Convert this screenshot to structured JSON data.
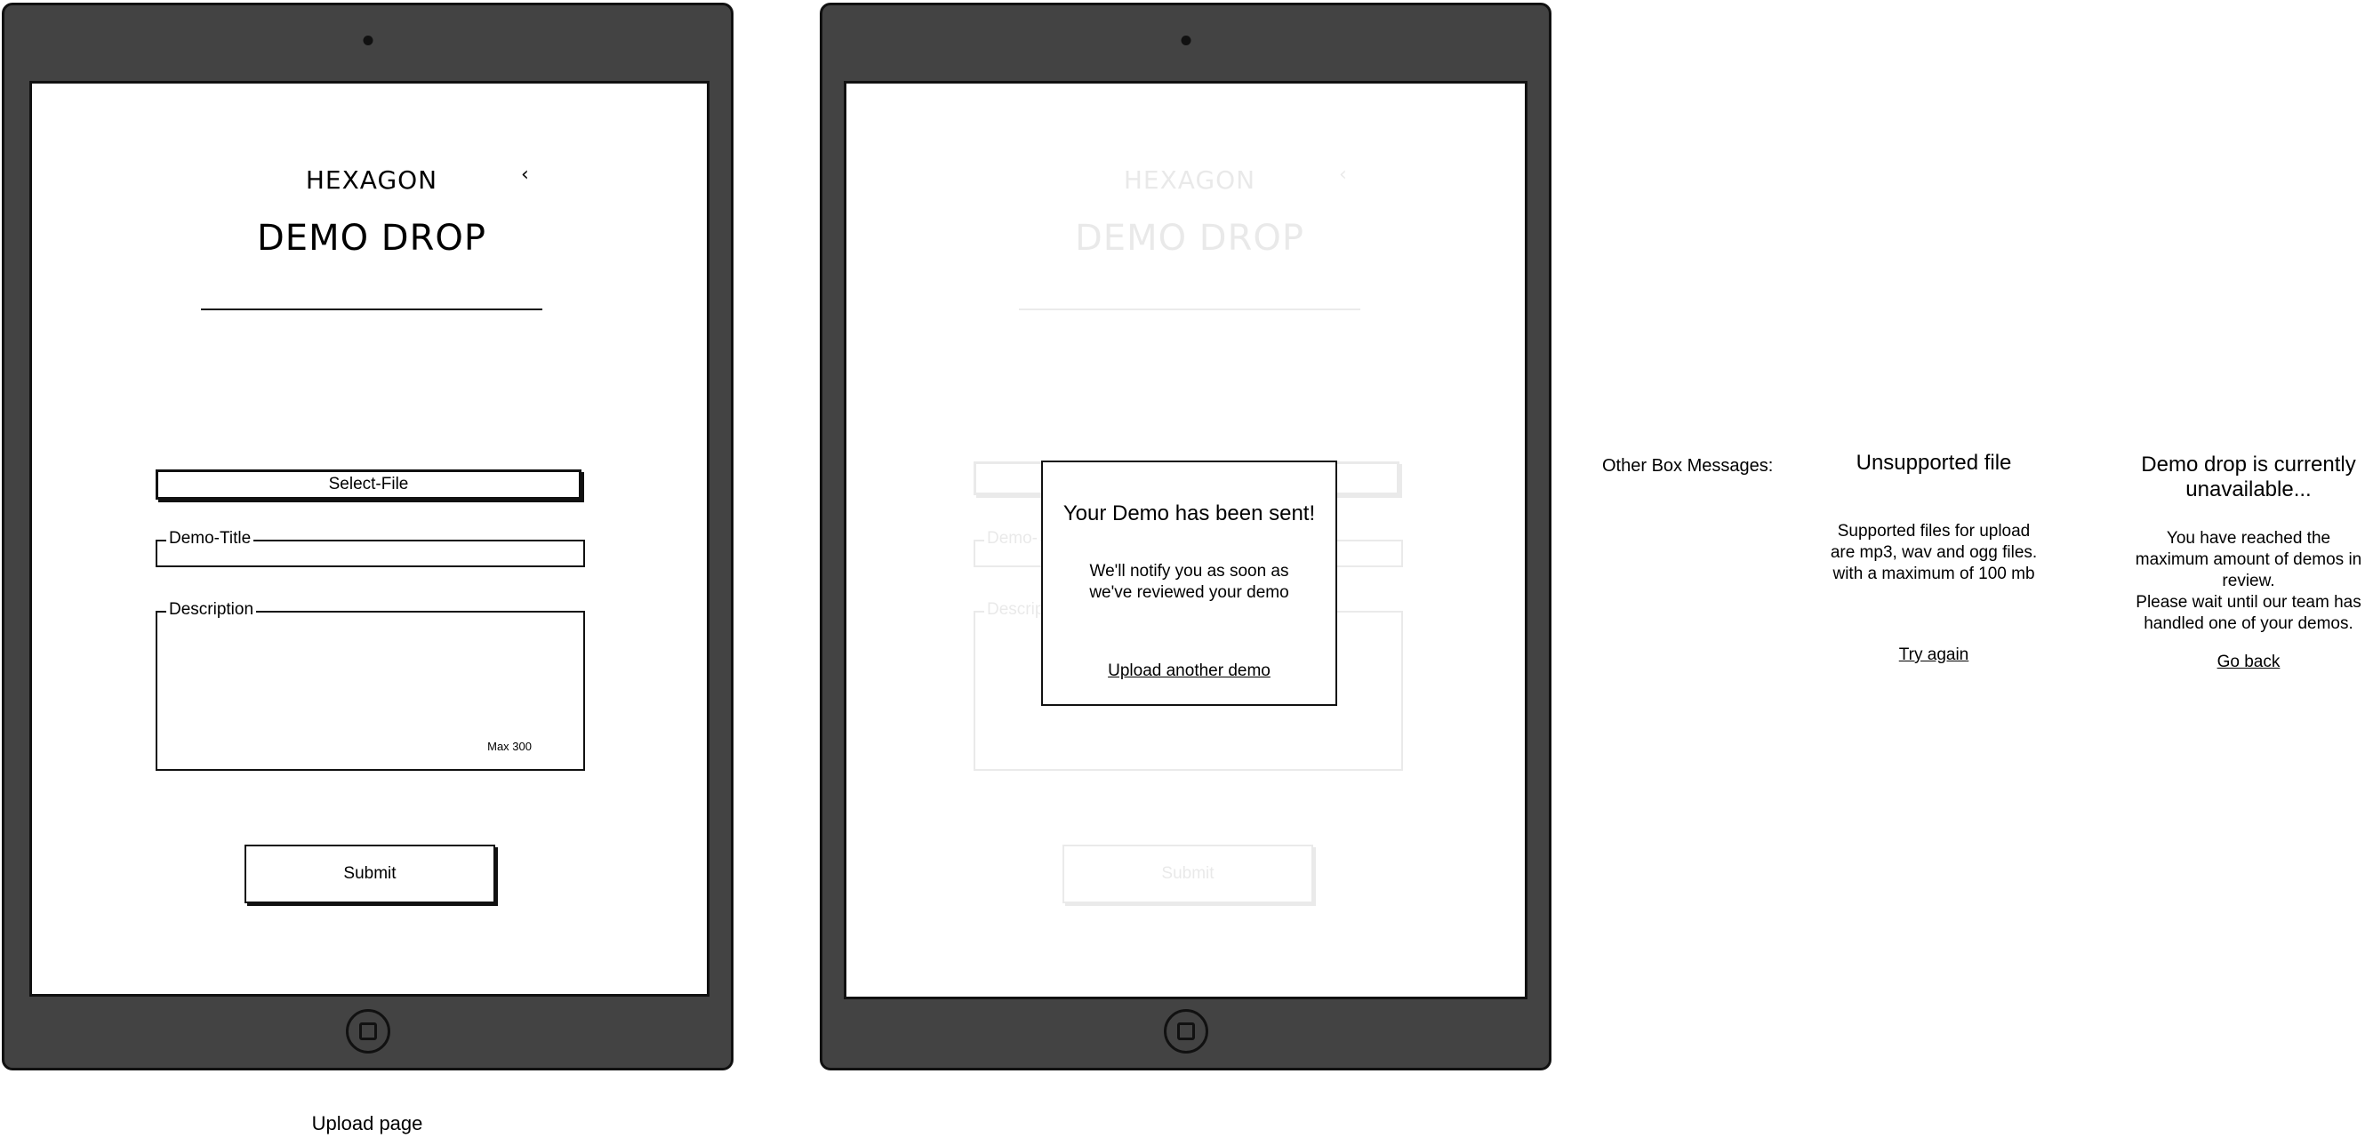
{
  "upload_page": {
    "logo": "HEXAGON",
    "title": "DEMO DROP",
    "back_icon": "‹",
    "select_file_label": "Select-File",
    "demo_title_label": "Demo-Title",
    "description_label": "Description",
    "description_max": "Max 300",
    "submit_label": "Submit",
    "caption": "Upload page"
  },
  "sent_page": {
    "logo": "HEXAGON",
    "title": "DEMO DROP",
    "back_icon": "‹",
    "demo_title_label": "Demo-",
    "description_label": "Descrip",
    "submit_label": "Submit",
    "modal": {
      "title": "Your Demo has been sent!",
      "body_line1": "We'll notify you as soon as",
      "body_line2": "we've reviewed your demo",
      "link": "Upload another demo"
    }
  },
  "other_messages": {
    "heading": "Other Box Messages:",
    "unsupported": {
      "title": "Unsupported file",
      "line1": "Supported files for upload",
      "line2": "are mp3, wav and ogg files.",
      "line3": "with a maximum of 100 mb",
      "link": "Try again"
    },
    "unavailable": {
      "title_line1": "Demo drop is currently",
      "title_line2": "unavailable...",
      "line1": "You have reached the",
      "line2": "maximum amount of demos in",
      "line3": "review.",
      "line4": "Please wait until our team has",
      "line5": "handled one of your demos.",
      "link": "Go back"
    }
  },
  "colors": {
    "tablet_body": "#434343",
    "outline": "#111111",
    "screen": "#ffffff"
  }
}
